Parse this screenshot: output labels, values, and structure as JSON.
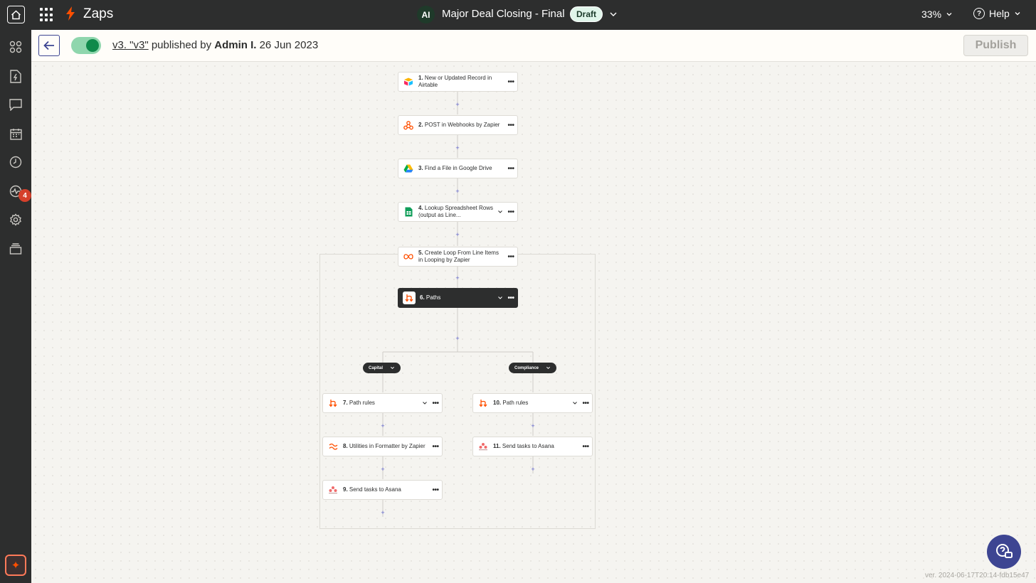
{
  "topbar": {
    "brand": "Zaps",
    "avatar_initials": "AI",
    "zap_title": "Major Deal Closing - Final",
    "status_badge": "Draft",
    "zoom": "33%",
    "help_label": "Help",
    "icons": {
      "home": "home-icon",
      "apps": "apps-grid-icon",
      "brand": "zapier-bolt-icon",
      "chevron": "chevron-down-icon",
      "help": "help-circle-icon"
    }
  },
  "sidebar": {
    "items": [
      {
        "icon": "apps-icon"
      },
      {
        "icon": "zap-file-icon"
      },
      {
        "icon": "chat-icon"
      },
      {
        "icon": "calendar-icon"
      },
      {
        "icon": "history-icon"
      },
      {
        "icon": "activity-icon",
        "badge": "4"
      },
      {
        "icon": "settings-icon"
      },
      {
        "icon": "layers-icon"
      }
    ],
    "copilot_icon": "sparkle-icon"
  },
  "version_bar": {
    "version_link": "v3. \"v3\"",
    "published_by_text": " published by ",
    "author": "Admin I.",
    "date": " 26 Jun 2023",
    "publish_label": "Publish",
    "toggle_on": true
  },
  "steps": {
    "s1": {
      "num": "1.",
      "label": "New or Updated Record in Airtable",
      "icon": "airtable-icon"
    },
    "s2": {
      "num": "2.",
      "label": "POST in Webhooks by Zapier",
      "icon": "webhooks-icon"
    },
    "s3": {
      "num": "3.",
      "label": "Find a File in Google Drive",
      "icon": "google-drive-icon"
    },
    "s4": {
      "num": "4.",
      "label": "Lookup Spreadsheet Rows (output as Line...",
      "icon": "google-sheets-icon"
    },
    "s5": {
      "num": "5.",
      "label": "Create Loop From Line Items in Looping by Zapier",
      "icon": "looping-icon"
    },
    "s6": {
      "num": "6.",
      "label": "Paths",
      "icon": "paths-icon"
    },
    "s7": {
      "num": "7.",
      "label": "Path rules",
      "icon": "paths-icon"
    },
    "s8": {
      "num": "8.",
      "label": "Utilities in Formatter by Zapier",
      "icon": "formatter-icon"
    },
    "s9": {
      "num": "9.",
      "label": "Send tasks to Asana",
      "icon": "asana-icon"
    },
    "s10": {
      "num": "10.",
      "label": "Path rules",
      "icon": "paths-icon"
    },
    "s11": {
      "num": "11.",
      "label": "Send tasks to Asana",
      "icon": "asana-icon"
    }
  },
  "branches": {
    "left": "Capital",
    "right": "Compliance"
  },
  "more_label": "•••",
  "plus_label": "+",
  "footer": {
    "version": "ver. 2024-06-17T20:14-fdb15e47",
    "help_fab_icon": "support-chat-icon"
  },
  "colors": {
    "brand_orange": "#ff4f00",
    "dark": "#2d2e2e",
    "accent_blue": "#3d4592",
    "toggle_green": "#0f8a4b",
    "badge_red": "#d5402b"
  }
}
